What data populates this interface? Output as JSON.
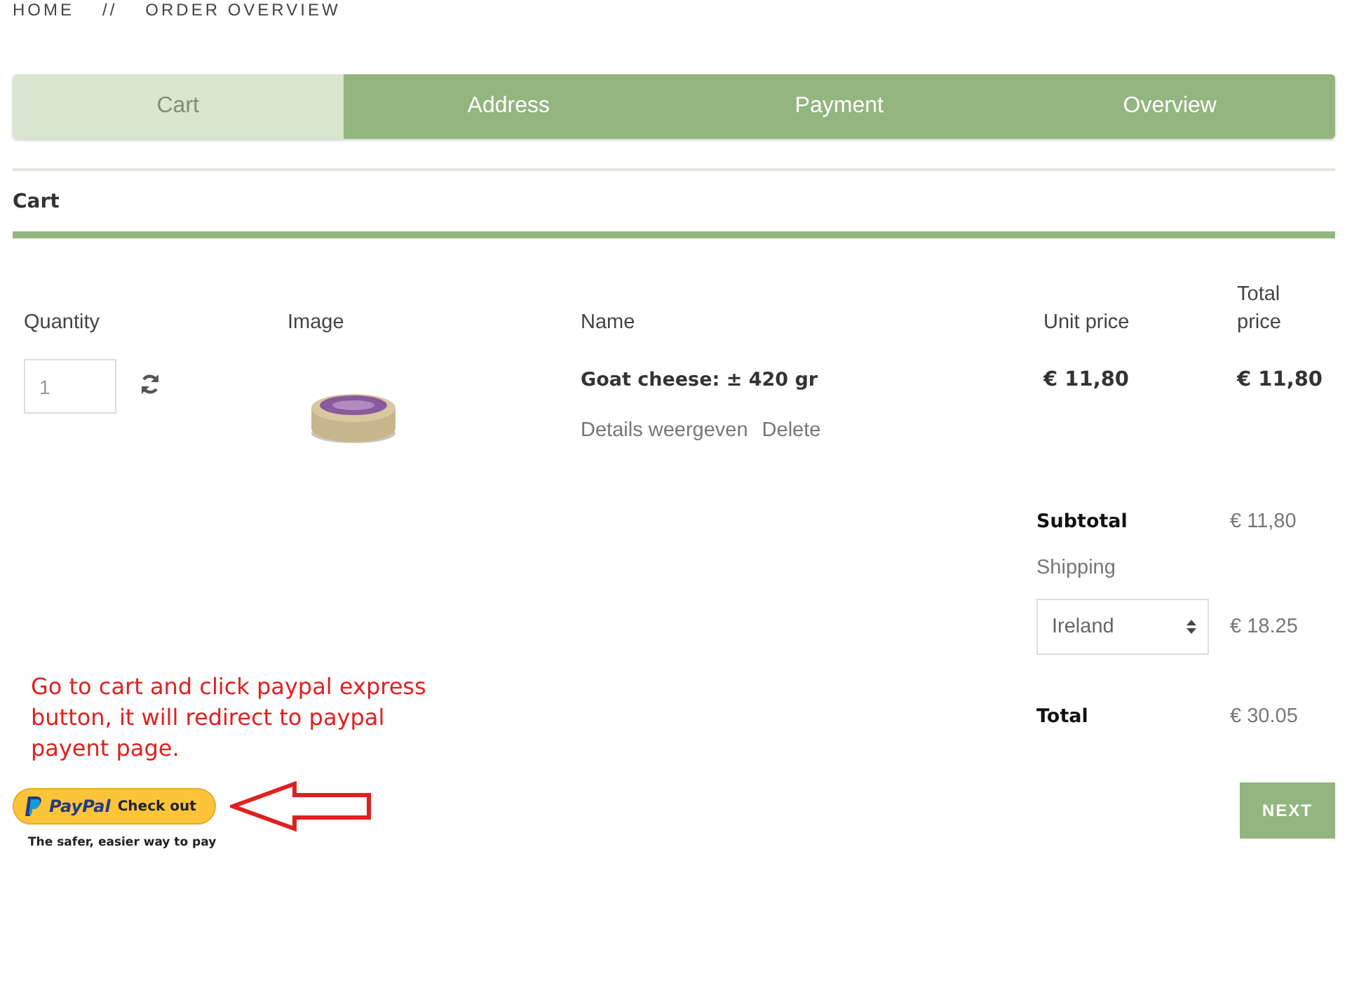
{
  "breadcrumb": {
    "items": [
      "HOME",
      "ORDER OVERVIEW"
    ],
    "separator": "//"
  },
  "steps": [
    {
      "label": "Cart",
      "selected": true
    },
    {
      "label": "Address",
      "selected": false
    },
    {
      "label": "Payment",
      "selected": false
    },
    {
      "label": "Overview",
      "selected": false
    }
  ],
  "section_title": "Cart",
  "table": {
    "columns": [
      "Quantity",
      "Image",
      "Name",
      "Unit price",
      "Total price"
    ],
    "rows": [
      {
        "quantity": "1",
        "name": "Goat cheese: ± 420 gr",
        "links": [
          "Details weergeven",
          "Delete"
        ],
        "unit_price": "€ 11,80",
        "total_price": "€ 11,80"
      }
    ]
  },
  "summary": {
    "subtotal_label": "Subtotal",
    "subtotal": "€ 11,80",
    "shipping_label": "Shipping",
    "shipping_country": "Ireland",
    "shipping_cost": "€ 18.25",
    "total_label": "Total",
    "total": "€ 30.05"
  },
  "annotation": "Go to cart and click paypal express button, it will redirect to paypal payent page.",
  "paypal": {
    "brand": "PayPal",
    "label": "Check out",
    "tagline": "The safer, easier way to pay"
  },
  "next_button": "NEXT"
}
